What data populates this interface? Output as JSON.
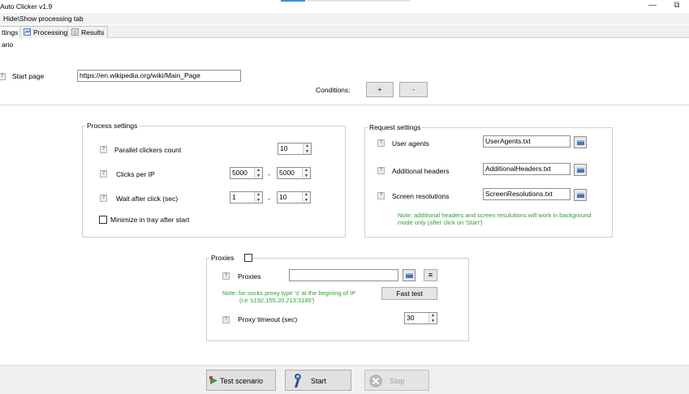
{
  "window": {
    "title": "Auto Clicker v1.9",
    "controls": {
      "minimize": "—",
      "restore": "⧉"
    }
  },
  "menu": {
    "toggle_tab": "Hide\\Show processing tab"
  },
  "tabs": [
    {
      "label": "ttings",
      "icon": "settings-icon",
      "active": true
    },
    {
      "label": "Processing",
      "icon": "processing-icon",
      "active": false
    },
    {
      "label": "Results",
      "icon": "results-icon",
      "active": false
    }
  ],
  "scenario": {
    "group_label": "ario",
    "question_mark": "?",
    "start_page_label": "Start page",
    "start_page_value": "https://en.wikipedia.org/wiki/Main_Page",
    "conditions_label": "Conditions:",
    "add_button": "+",
    "remove_button": "-"
  },
  "process_settings": {
    "title": "Process settings",
    "parallel_label": "Parallel clickers count",
    "parallel_value": "10",
    "clicks_label": "Clicks per IP",
    "clicks_from": "5000",
    "clicks_to": "5000",
    "wait_label": "Wait after click (sec)",
    "wait_from": "1",
    "wait_to": "10",
    "range_separator": "-",
    "minimize_label": "Minimize in tray after start",
    "minimize_checked": false
  },
  "request_settings": {
    "title": "Request settings",
    "user_agents_label": "User agents",
    "user_agents_value": "UserAgents.txt",
    "headers_label": "Additional headers",
    "headers_value": "AdditionalHeaders.txt",
    "resolutions_label": "Screen resolutions",
    "resolutions_value": "ScreenResolutions.txt",
    "note_line1": "Note: additional headers and screen resulutions will work in background",
    "note_line2": "mode only (after click on 'Start')"
  },
  "proxies": {
    "title": "Proxies",
    "enabled": false,
    "proxies_label": "Proxies",
    "proxies_value": "",
    "menu_button": "≡",
    "note_line1": "Note: for socks proxy type 's' at the begining of IP",
    "note_line2": "(i.e 's192.155.20.213:3185')",
    "fast_test_button": "Fast test",
    "timeout_label": "Proxy timeout (sec)",
    "timeout_value": "30"
  },
  "actions": {
    "test_scenario": "Test scenario",
    "start": "Start",
    "stop": "Stop"
  },
  "colors": {
    "accent": "#3b8fd6",
    "note_green": "#2d9f2d",
    "folder_blue": "#4a76b6"
  }
}
